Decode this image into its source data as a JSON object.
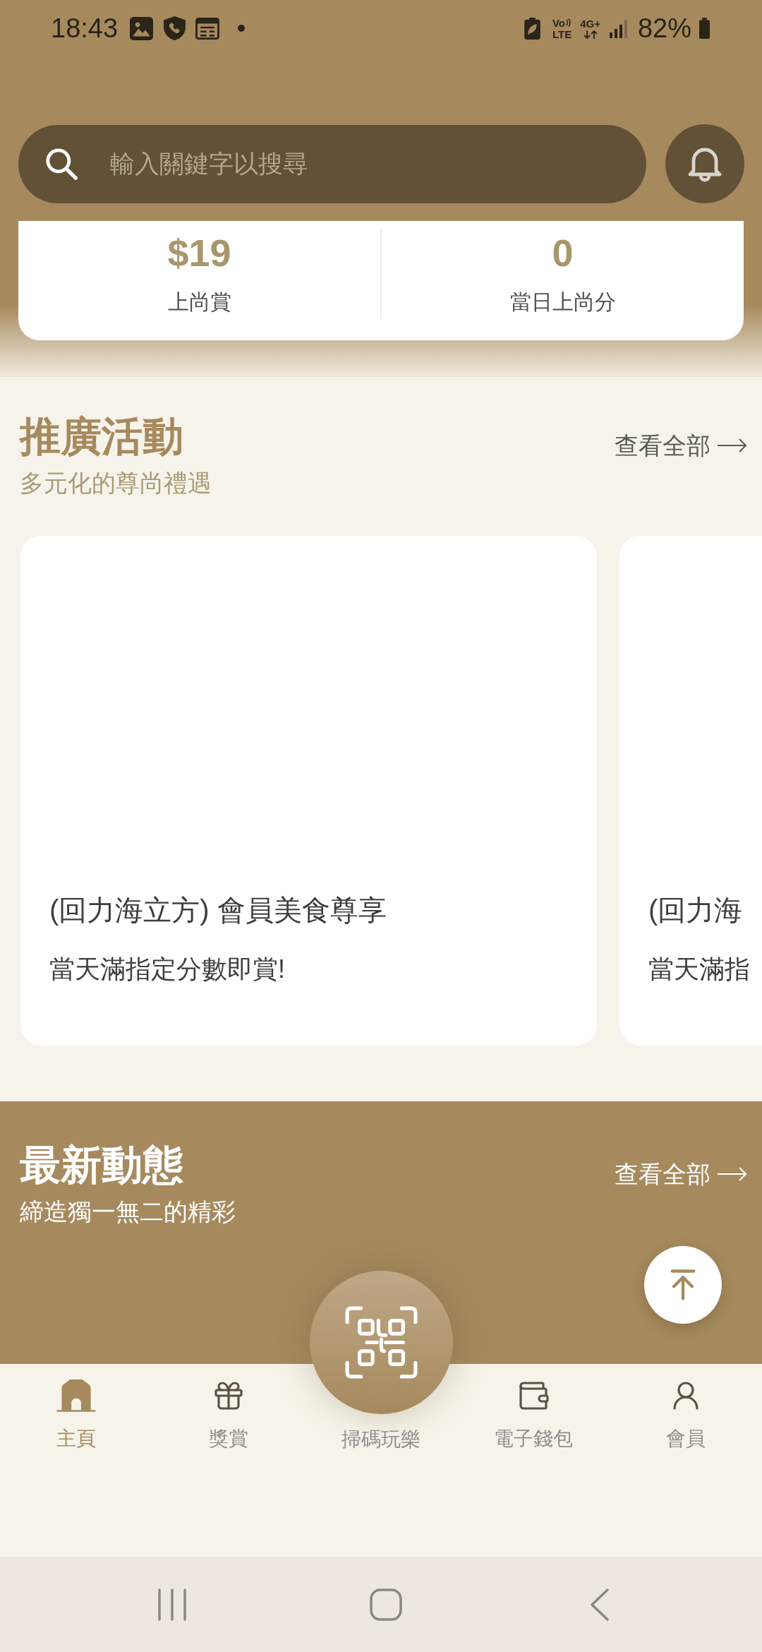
{
  "status_bar": {
    "time": "18:43",
    "volte_top": "Vo",
    "volte_bottom": "LTE",
    "network": "4G+",
    "battery": "82%"
  },
  "search": {
    "placeholder": "輸入關鍵字以搜尋"
  },
  "stats": [
    {
      "value": "$19",
      "label": "上尚賞"
    },
    {
      "value": "0",
      "label": "當日上尚分"
    }
  ],
  "promotions": {
    "title": "推廣活動",
    "subtitle": "多元化的尊尚禮遇",
    "see_all": "查看全部",
    "cards": [
      {
        "title": "(回力海立方) 會員美食尊享",
        "subtitle": "當天滿指定分數即賞!"
      },
      {
        "title": "(回力海",
        "subtitle": "當天滿指"
      }
    ]
  },
  "news": {
    "title": "最新動態",
    "subtitle": "締造獨一無二的精彩",
    "see_all": "查看全部"
  },
  "bottom_nav": [
    {
      "label": "主頁",
      "kind": "tab",
      "selected": true
    },
    {
      "label": "獎賞",
      "kind": "tab",
      "selected": false
    },
    {
      "label": "掃碼玩樂",
      "kind": "scan",
      "selected": false
    },
    {
      "label": "電子錢包",
      "kind": "tab",
      "selected": false
    },
    {
      "label": "會員",
      "kind": "tab",
      "selected": false
    }
  ]
}
